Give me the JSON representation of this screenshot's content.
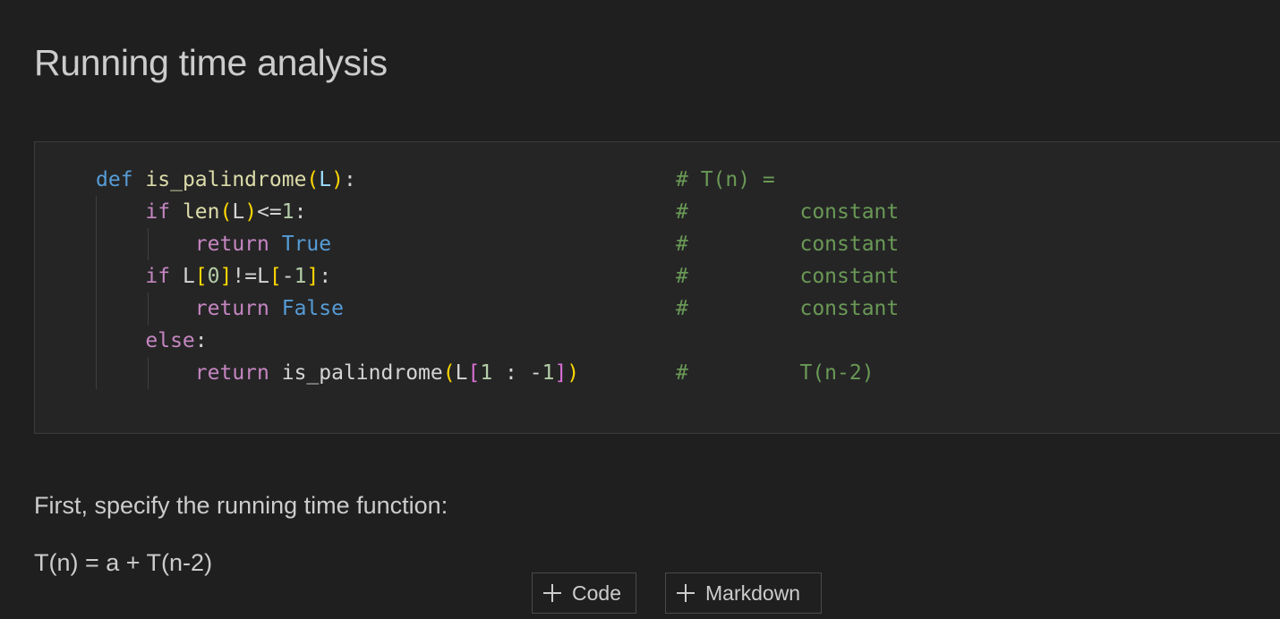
{
  "heading": "Running time analysis",
  "code": {
    "lines": [
      {
        "tokens": [
          [
            "kw-blue",
            "def"
          ],
          [
            "plain",
            " "
          ],
          [
            "fn",
            "is_palindrome"
          ],
          [
            "br1",
            "("
          ],
          [
            "param",
            "L"
          ],
          [
            "br1",
            ")"
          ],
          [
            "plain",
            ":"
          ]
        ],
        "comment": "# T(n) ="
      },
      {
        "tokens": [
          [
            "plain",
            "    "
          ],
          [
            "kw-pink",
            "if"
          ],
          [
            "plain",
            " "
          ],
          [
            "fn",
            "len"
          ],
          [
            "br1",
            "("
          ],
          [
            "plain",
            "L"
          ],
          [
            "br1",
            ")"
          ],
          [
            "plain",
            "<="
          ],
          [
            "num",
            "1"
          ],
          [
            "plain",
            ":"
          ]
        ],
        "comment": "#         constant"
      },
      {
        "tokens": [
          [
            "plain",
            "        "
          ],
          [
            "kw-pink",
            "return"
          ],
          [
            "plain",
            " "
          ],
          [
            "kw-blue",
            "True"
          ]
        ],
        "comment": "#         constant"
      },
      {
        "tokens": [
          [
            "plain",
            "    "
          ],
          [
            "kw-pink",
            "if"
          ],
          [
            "plain",
            " L"
          ],
          [
            "br1",
            "["
          ],
          [
            "num",
            "0"
          ],
          [
            "br1",
            "]"
          ],
          [
            "plain",
            "!=L"
          ],
          [
            "br1",
            "["
          ],
          [
            "plain",
            "-"
          ],
          [
            "num",
            "1"
          ],
          [
            "br1",
            "]"
          ],
          [
            "plain",
            ":"
          ]
        ],
        "comment": "#         constant"
      },
      {
        "tokens": [
          [
            "plain",
            "        "
          ],
          [
            "kw-pink",
            "return"
          ],
          [
            "plain",
            " "
          ],
          [
            "kw-blue",
            "False"
          ]
        ],
        "comment": "#         constant"
      },
      {
        "tokens": [
          [
            "plain",
            "    "
          ],
          [
            "kw-pink",
            "else"
          ],
          [
            "plain",
            ":"
          ]
        ],
        "comment": ""
      },
      {
        "tokens": [
          [
            "plain",
            "        "
          ],
          [
            "kw-pink",
            "return"
          ],
          [
            "plain",
            " is_palindrome"
          ],
          [
            "br1",
            "("
          ],
          [
            "plain",
            "L"
          ],
          [
            "br2",
            "["
          ],
          [
            "num",
            "1"
          ],
          [
            "plain",
            " : -"
          ],
          [
            "num",
            "1"
          ],
          [
            "br2",
            "]"
          ],
          [
            "br1",
            ")"
          ]
        ],
        "comment": "#         T(n-2)"
      }
    ]
  },
  "paragraphs": {
    "first": "First, specify the running time function:",
    "second": "T(n) = a + T(n-2)"
  },
  "toolbar": {
    "add_code_label": "Code",
    "add_markdown_label": "Markdown"
  }
}
